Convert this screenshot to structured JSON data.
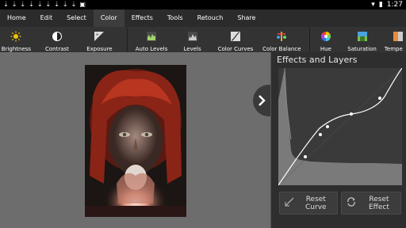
{
  "status_bar": {
    "time": "1:27",
    "icons": [
      "download-icon",
      "download-icon",
      "download-icon",
      "download-icon",
      "download-icon",
      "download-icon",
      "download-icon",
      "download-icon",
      "download-icon",
      "photo-icon"
    ]
  },
  "menu": {
    "items": [
      {
        "label": "Home"
      },
      {
        "label": "Edit"
      },
      {
        "label": "Select"
      },
      {
        "label": "Color",
        "active": true
      },
      {
        "label": "Effects"
      },
      {
        "label": "Tools"
      },
      {
        "label": "Retouch"
      },
      {
        "label": "Share"
      }
    ]
  },
  "toolbar": {
    "tools": [
      {
        "label": "Brightness",
        "icon": "brightness-icon"
      },
      {
        "label": "Contrast",
        "icon": "contrast-icon"
      },
      {
        "label": "Exposure",
        "icon": "exposure-icon"
      },
      {
        "label": "Auto Levels",
        "icon": "auto-levels-icon"
      },
      {
        "label": "Levels",
        "icon": "levels-icon"
      },
      {
        "label": "Color Curves",
        "icon": "color-curves-icon"
      },
      {
        "label": "Color Balance",
        "icon": "color-balance-icon"
      },
      {
        "label": "Hue",
        "icon": "hue-icon"
      },
      {
        "label": "Saturation",
        "icon": "saturation-icon"
      },
      {
        "label": "Tempe",
        "icon": "temperature-icon"
      }
    ]
  },
  "panel": {
    "title": "Effects and Layers",
    "reset_curve": {
      "line1": "Reset",
      "line2": "Curve"
    },
    "reset_effect": {
      "line1": "Reset",
      "line2": "Effect"
    }
  },
  "colors": {
    "accent_red": "#c0392b",
    "panel_bg": "#2e2e2e",
    "menu_bg": "#2b2b2b"
  }
}
